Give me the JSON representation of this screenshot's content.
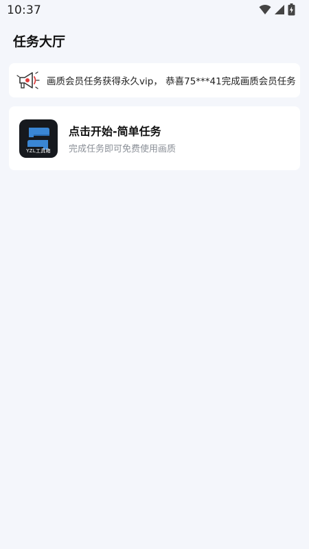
{
  "status_bar": {
    "time": "10:37",
    "icons": [
      "wifi-icon",
      "signal-icon",
      "battery-charging-icon"
    ]
  },
  "header": {
    "title": "任务大厅"
  },
  "notice": {
    "icon": "megaphone-icon",
    "text": "画质会员任务获得永久vip， 恭喜75***41完成画质会员任务"
  },
  "tasks": [
    {
      "logo_icon": "yzl-toolbox-logo",
      "logo_caption": "YZL工具箱",
      "title": "点击开始-简单任务",
      "subtitle": "完成任务即可免费使用画质"
    }
  ],
  "colors": {
    "background": "#f4f6fb",
    "card": "#ffffff",
    "logo_background": "#16191e",
    "logo_accent": "#3a86d4",
    "subtitle_text": "#8a8f97"
  }
}
